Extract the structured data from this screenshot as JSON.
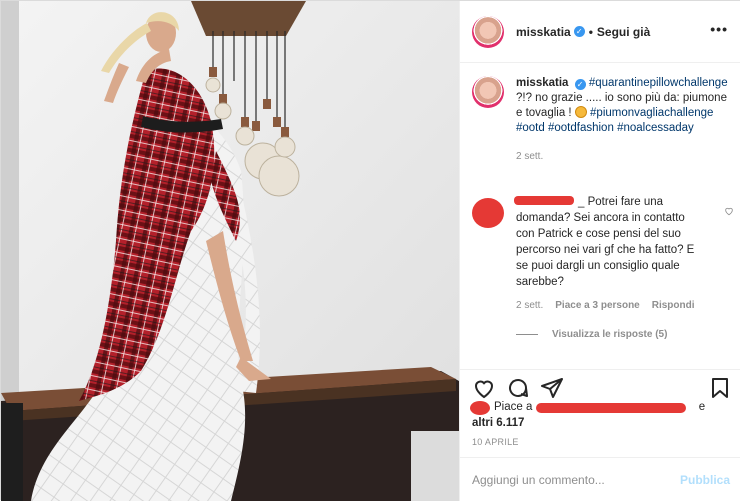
{
  "header": {
    "username": "misskatia",
    "separator": "•",
    "follow_label": "Segui già",
    "more_label": "•••"
  },
  "caption": {
    "username": "misskatia",
    "tag1": "#quarantinepillowchallenge",
    "text1": " ?!? no grazie ..... io sono più da: piumone e tovaglia ! ",
    "tag2": "#piumonvagliachallenge",
    "tag3": "#ootd",
    "tag4": "#ootdfashion",
    "tag5": "#noalcessaday",
    "time": "2 sett."
  },
  "comment": {
    "text": "_ Potrei fare una domanda? Sei ancora in contatto con Patrick e cose pensi del suo percorso nei vari gf che ha fatto? E se puoi dargli un consiglio quale sarebbe?",
    "time": "2 sett.",
    "likes": "Piace a 3 persone",
    "reply": "Rispondi",
    "view_replies": "Visualizza le risposte (5)"
  },
  "likes": {
    "prefix": "Piace a",
    "suffix": "e",
    "others": "altri 6.117"
  },
  "date": "10 APRILE",
  "add_comment": {
    "placeholder": "Aggiungi un commento...",
    "publish_label": "Pubblica"
  },
  "icons": {
    "like": "heart-icon",
    "comment": "comment-icon",
    "share": "share-icon",
    "save": "bookmark-icon",
    "verified": "verified-badge-icon"
  },
  "colors": {
    "link": "#00376b",
    "verified": "#3897f0",
    "publish_disabled": "#b2dffc",
    "redaction": "#e53935",
    "muted": "#8e8e8e"
  }
}
